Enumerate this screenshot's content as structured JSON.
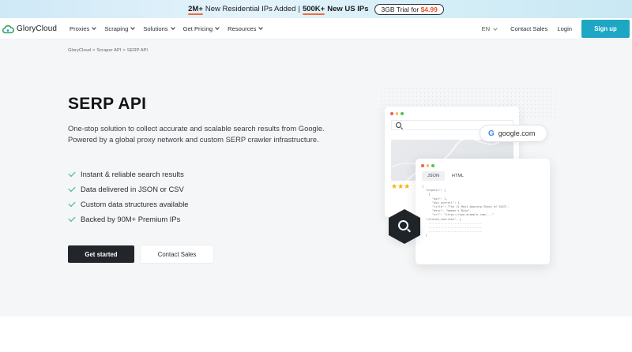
{
  "announcement": {
    "part1_number": "2M+",
    "part1_text": "New Residential IPs Added",
    "separator": "|",
    "part2_number": "500K+",
    "part2_text": "New US IPs",
    "trial_text": "3GB Trial for",
    "trial_price": "$4.99"
  },
  "nav": {
    "brand": "GloryCloud",
    "menu": [
      {
        "label": "Proxies"
      },
      {
        "label": "Scraping"
      },
      {
        "label": "Solutions"
      },
      {
        "label": "Get Pricing"
      },
      {
        "label": "Resources"
      }
    ],
    "language": "EN",
    "contact_sales": "Contact Sales",
    "login": "Login",
    "signup": "Sign up"
  },
  "breadcrumb": [
    "GloryCloud",
    ">",
    "Scraper API",
    ">",
    "SERP API"
  ],
  "hero": {
    "title": "SERP API",
    "description": "One-stop solution to collect accurate and scalable search results from Google. Powered by a global proxy network and custom SERP crawler infrastructure.",
    "features": [
      "Instant & reliable search results",
      "Data delivered in JSON or CSV",
      "Custom data structures available",
      "Backed by 90M+ Premium IPs"
    ],
    "primary_button": "Get started",
    "secondary_button": "Contact Sales"
  },
  "illustration": {
    "google_pill": "google.com",
    "google_letter": "G",
    "stars": "★★★",
    "tabs": [
      "JSON",
      "HTML"
    ],
    "code": "{\n  \"organic\": [\n    {\n      \"pos\": 1,\n      \"pos_overall\": 1,\n      \"title\": \"The 11 Most Amazing Shoes of 2023\",\n      \"desc\": \"Women's Nike\",\n      \"url\": \"https://www.example.com/...\"\n  \"related_searches\": {\n    ...............................\n    ...............................\n    ...............................\n  }",
    "dot_colors": [
      "#f0645a",
      "#f5be4f",
      "#5ac05a"
    ],
    "icon_names": [
      "search-icon",
      "google-logo-icon",
      "magnifier-hex-icon"
    ]
  },
  "colors": {
    "accent": "#1ea7c4",
    "check": "#34b57a",
    "highlight_underline": "#f06a3a",
    "price": "#e8532b",
    "dark_button": "#22262b"
  }
}
